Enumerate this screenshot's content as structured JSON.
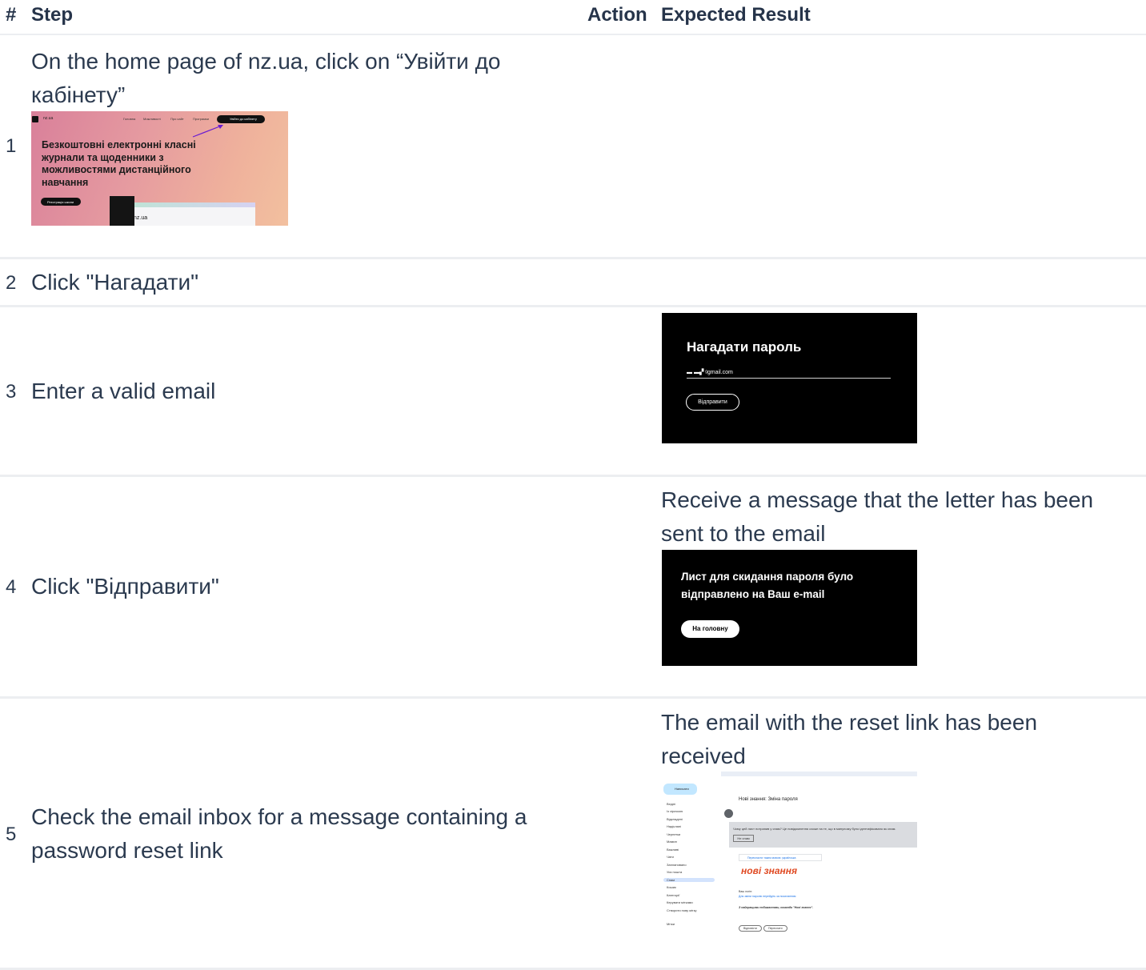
{
  "headers": {
    "num": "#",
    "step": "Step",
    "action": "Action",
    "expected": "Expected Result"
  },
  "rows": [
    {
      "num": "1",
      "step_line1": "On the home page of nz.ua, click on “Увійти до",
      "step_line2": "кабінету”",
      "thumb": {
        "logo_text": "nz.ua",
        "nav": [
          "Головна",
          "Можливості",
          "Про сайт",
          "Програмки"
        ],
        "login_button": "Увійти до кабінету",
        "headline": "Безкоштовні електронні класні журнали та щоденники з можливостями дистанційного навчання",
        "register_button": "Реєстрація школи",
        "preview_label": "nz.ua"
      }
    },
    {
      "num": "2",
      "step": "Click \"Нагадати\""
    },
    {
      "num": "3",
      "step": "Enter a valid email",
      "thumb": {
        "title": "Нагадати пароль",
        "email": "▬ ▬▞ ᵍgmail.com",
        "button": "Відправити"
      }
    },
    {
      "num": "4",
      "step": "Click \"Відправити\"",
      "expected_line1": "Receive a message that the letter has been",
      "expected_line2": "sent to the email",
      "thumb": {
        "message": "Лист для скидання пароля було відправлено на Ваш e-mail",
        "button": "На головну"
      }
    },
    {
      "num": "5",
      "step_line1": "Check the email inbox for a message containing a",
      "step_line2": "password reset link",
      "expected_line1": "The email with the reset link has been",
      "expected_line2": "received",
      "thumb": {
        "compose": "Написати",
        "folders": [
          "Вхідні",
          "Із зірочкою",
          "Відкладені",
          "Надіслані",
          "Чернетки",
          "Мамин",
          "Важливі",
          "Чати",
          "Заплановано",
          "Уся пошта",
          "Спам",
          "Кошик",
          "Категорії",
          "Керувати мітками",
          "Створити нову мітку"
        ],
        "labels_title": "Мітки",
        "subject": "Нові знання: Зміна пароля",
        "spam_notice": "Чому цей лист потрапив у спам? Це повідомлення схоже на те, що в минулому було ідентифіковано як спам.",
        "spam_button": "Не спам",
        "banner": "Перекласти таким мовою: українська",
        "brand": "нові знання",
        "your_login": "Ваш логін:",
        "reset_link": "Для зміни паролю перейдіть за посиланням",
        "signature": "З найкращими побажаннями, команда \"Нові знання\".",
        "reply": "Відповісти",
        "forward": "Переслати"
      }
    }
  ]
}
